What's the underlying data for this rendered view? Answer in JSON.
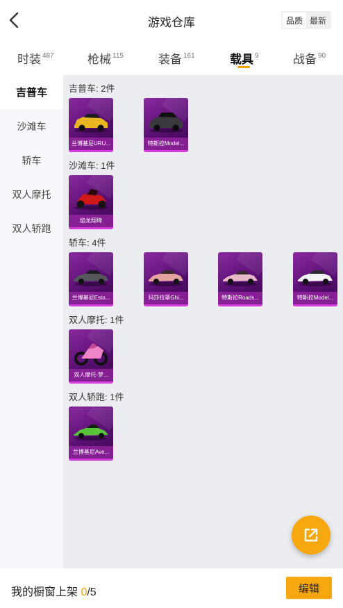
{
  "header": {
    "title": "游戏仓库",
    "sort_options": [
      "品质",
      "最新"
    ]
  },
  "tabs": [
    {
      "label": "时装",
      "count": "487"
    },
    {
      "label": "枪械",
      "count": "115"
    },
    {
      "label": "装备",
      "count": "161"
    },
    {
      "label": "载具",
      "count": "9"
    },
    {
      "label": "战备",
      "count": "90"
    }
  ],
  "sidebar": {
    "items": [
      "吉普车",
      "沙滩车",
      "轿车",
      "双人摩托",
      "双人轿跑"
    ]
  },
  "groups": [
    {
      "title": "吉普车: 2件",
      "items": [
        {
          "name": "兰博基尼URU...",
          "color": "#e9b520"
        },
        {
          "name": "特斯拉Model...",
          "color": "#3a3a3e"
        }
      ]
    },
    {
      "title": "沙滩车: 1件",
      "items": [
        {
          "name": "焰龙翔璋",
          "color": "#d01818"
        }
      ]
    },
    {
      "title": "轿车: 4件",
      "items": [
        {
          "name": "兰博基尼Esto...",
          "color": "#55575c"
        },
        {
          "name": "玛莎拉蒂Ghi...",
          "color": "#e4a3a0"
        },
        {
          "name": "特斯拉Roads...",
          "color": "#e8b9c9"
        },
        {
          "name": "特斯拉Model...",
          "color": "#f4f4f6"
        }
      ]
    },
    {
      "title": "双人摩托: 1件",
      "items": [
        {
          "name": "双人摩托-梦...",
          "color": "#ef85c6"
        }
      ]
    },
    {
      "title": "双人轿跑: 1件",
      "items": [
        {
          "name": "兰博基尼Ave...",
          "color": "#57c43a"
        }
      ]
    }
  ],
  "bottom": {
    "shelf_label": "我的橱窗上架 ",
    "current": "0",
    "total": "/5",
    "edit_label": "编辑"
  }
}
